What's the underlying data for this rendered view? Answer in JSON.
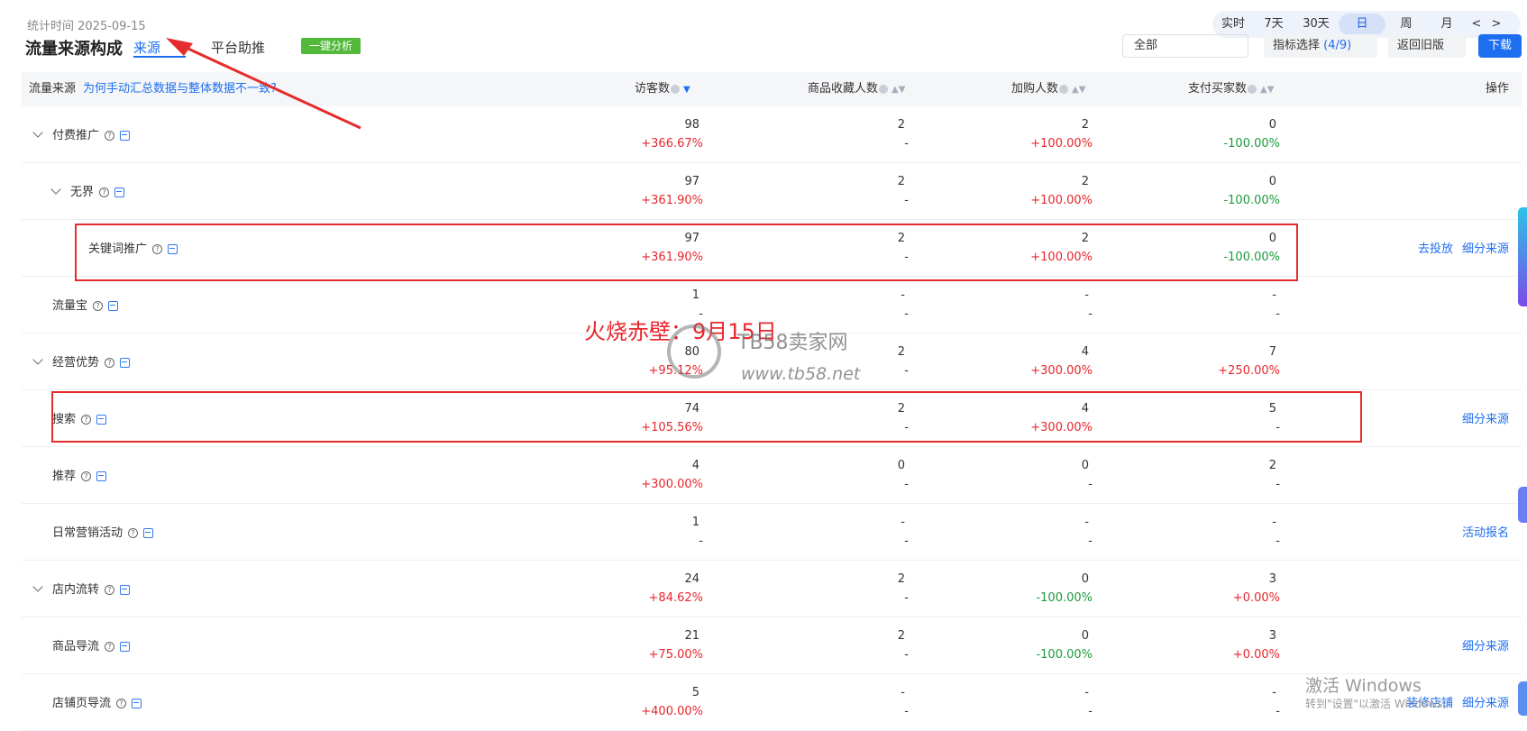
{
  "stat_time": "统计时间 2025-09-15",
  "time_tabs": [
    "实时",
    "7天",
    "30天",
    "日",
    "周",
    "月",
    "<",
    ">"
  ],
  "time_tab_active": "日",
  "header": {
    "title": "流量来源构成",
    "tab_source": "来源",
    "tab_platform": "平台助推",
    "analyze_btn": "一键分析",
    "filter_label": "全部",
    "indicator_label": "指标选择",
    "indicator_count": "(4/9)",
    "back_label": "返回旧版",
    "download_label": "下载"
  },
  "table": {
    "columns": {
      "source": "流量来源",
      "help_link": "为何手动汇总数据与整体数据不一致?",
      "visitors": "访客数",
      "fav": "商品收藏人数",
      "cart": "加购人数",
      "buyers": "支付买家数",
      "ops": "操作"
    },
    "rows": [
      {
        "name": "付费推广",
        "level": 0,
        "expand": true,
        "visitors": "98",
        "visitors_delta": "+366.67%",
        "fav": "2",
        "fav_delta": "-",
        "cart": "2",
        "cart_delta": "+100.00%",
        "buyers": "0",
        "buyers_delta": "-100.00%",
        "ops": []
      },
      {
        "name": "无界",
        "level": 1,
        "expand": true,
        "visitors": "97",
        "visitors_delta": "+361.90%",
        "fav": "2",
        "fav_delta": "-",
        "cart": "2",
        "cart_delta": "+100.00%",
        "buyers": "0",
        "buyers_delta": "-100.00%",
        "ops": []
      },
      {
        "name": "关键词推广",
        "level": 2,
        "expand": false,
        "visitors": "97",
        "visitors_delta": "+361.90%",
        "fav": "2",
        "fav_delta": "-",
        "cart": "2",
        "cart_delta": "+100.00%",
        "buyers": "0",
        "buyers_delta": "-100.00%",
        "ops": [
          "去投放",
          "细分来源"
        ]
      },
      {
        "name": "流量宝",
        "level": 1,
        "expand": false,
        "visitors": "1",
        "visitors_delta": "-",
        "fav": "-",
        "fav_delta": "-",
        "cart": "-",
        "cart_delta": "-",
        "buyers": "-",
        "buyers_delta": "-",
        "ops": []
      },
      {
        "name": "经营优势",
        "level": 0,
        "expand": true,
        "visitors": "80",
        "visitors_delta": "+95.12%",
        "fav": "2",
        "fav_delta": "-",
        "cart": "4",
        "cart_delta": "+300.00%",
        "buyers": "7",
        "buyers_delta": "+250.00%",
        "ops": []
      },
      {
        "name": "搜索",
        "level": 1,
        "expand": false,
        "visitors": "74",
        "visitors_delta": "+105.56%",
        "fav": "2",
        "fav_delta": "-",
        "cart": "4",
        "cart_delta": "+300.00%",
        "buyers": "5",
        "buyers_delta": "-",
        "ops": [
          "细分来源"
        ]
      },
      {
        "name": "推荐",
        "level": 1,
        "expand": false,
        "visitors": "4",
        "visitors_delta": "+300.00%",
        "fav": "0",
        "fav_delta": "-",
        "cart": "0",
        "cart_delta": "-",
        "buyers": "2",
        "buyers_delta": "-",
        "ops": []
      },
      {
        "name": "日常营销活动",
        "level": 1,
        "expand": false,
        "visitors": "1",
        "visitors_delta": "-",
        "fav": "-",
        "fav_delta": "-",
        "cart": "-",
        "cart_delta": "-",
        "buyers": "-",
        "buyers_delta": "-",
        "ops": [
          "活动报名"
        ]
      },
      {
        "name": "店内流转",
        "level": 0,
        "expand": true,
        "visitors": "24",
        "visitors_delta": "+84.62%",
        "fav": "2",
        "fav_delta": "-",
        "cart": "0",
        "cart_delta": "-100.00%",
        "buyers": "3",
        "buyers_delta": "+0.00%",
        "ops": []
      },
      {
        "name": "商品导流",
        "level": 1,
        "expand": false,
        "visitors": "21",
        "visitors_delta": "+75.00%",
        "fav": "2",
        "fav_delta": "-",
        "cart": "0",
        "cart_delta": "-100.00%",
        "buyers": "3",
        "buyers_delta": "+0.00%",
        "ops": [
          "细分来源"
        ]
      },
      {
        "name": "店铺页导流",
        "level": 1,
        "expand": false,
        "visitors": "5",
        "visitors_delta": "+400.00%",
        "fav": "-",
        "fav_delta": "-",
        "cart": "-",
        "cart_delta": "-",
        "buyers": "-",
        "buyers_delta": "-",
        "ops": [
          "装修店铺",
          "细分来源"
        ]
      }
    ]
  },
  "watermark": {
    "annotation": "火烧赤壁：9月15日",
    "brand": "TB58卖家网",
    "url": "www.tb58.net"
  },
  "windows": {
    "line1": "激活 Windows",
    "line2": "转到\"设置\"以激活 Windows。"
  },
  "colors": {
    "accent": "#1e6ef0",
    "positive": "#e8262c",
    "negative": "#1c9a3e",
    "highlight_box": "#e52b2b"
  }
}
